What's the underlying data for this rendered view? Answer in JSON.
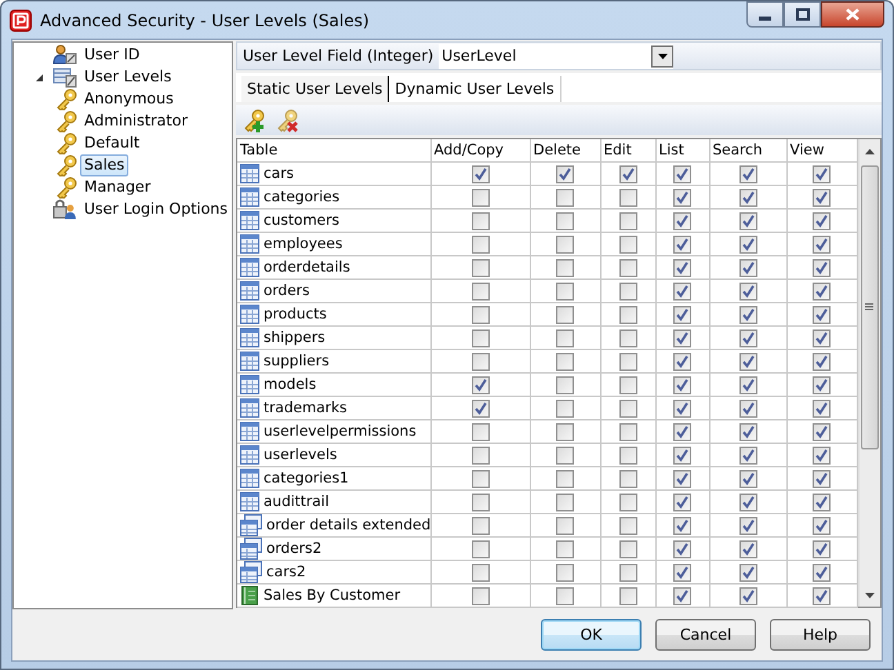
{
  "window": {
    "title": "Advanced Security - User Levels (Sales)"
  },
  "tree": [
    {
      "label": "User ID",
      "kind": "user-id",
      "selected": false
    },
    {
      "label": "User Levels",
      "kind": "user-levels",
      "selected": false,
      "expanded": true,
      "children": [
        {
          "label": "Anonymous",
          "kind": "key",
          "selected": false
        },
        {
          "label": "Administrator",
          "kind": "key",
          "selected": false
        },
        {
          "label": "Default",
          "kind": "key",
          "selected": false
        },
        {
          "label": "Sales",
          "kind": "key",
          "selected": true
        },
        {
          "label": "Manager",
          "kind": "key",
          "selected": false
        }
      ]
    },
    {
      "label": "User Login Options",
      "kind": "login",
      "selected": false
    }
  ],
  "field": {
    "label": "User Level Field (Integer)",
    "value": "UserLevel"
  },
  "tabs": [
    {
      "label": "Static User Levels",
      "selected": true
    },
    {
      "label": "Dynamic User Levels",
      "selected": false
    }
  ],
  "table": {
    "columns": [
      "Table",
      "Add/Copy",
      "Delete",
      "Edit",
      "List",
      "Search",
      "View"
    ],
    "rows": [
      {
        "name": "cars",
        "kind": "table",
        "checks": [
          true,
          true,
          true,
          true,
          true,
          true
        ]
      },
      {
        "name": "categories",
        "kind": "table",
        "checks": [
          false,
          false,
          false,
          true,
          true,
          true
        ]
      },
      {
        "name": "customers",
        "kind": "table",
        "checks": [
          false,
          false,
          false,
          true,
          true,
          true
        ]
      },
      {
        "name": "employees",
        "kind": "table",
        "checks": [
          false,
          false,
          false,
          true,
          true,
          true
        ]
      },
      {
        "name": "orderdetails",
        "kind": "table",
        "checks": [
          false,
          false,
          false,
          true,
          true,
          true
        ]
      },
      {
        "name": "orders",
        "kind": "table",
        "checks": [
          false,
          false,
          false,
          true,
          true,
          true
        ]
      },
      {
        "name": "products",
        "kind": "table",
        "checks": [
          false,
          false,
          false,
          true,
          true,
          true
        ]
      },
      {
        "name": "shippers",
        "kind": "table",
        "checks": [
          false,
          false,
          false,
          true,
          true,
          true
        ]
      },
      {
        "name": "suppliers",
        "kind": "table",
        "checks": [
          false,
          false,
          false,
          true,
          true,
          true
        ]
      },
      {
        "name": "models",
        "kind": "table",
        "checks": [
          true,
          false,
          false,
          true,
          true,
          true
        ]
      },
      {
        "name": "trademarks",
        "kind": "table",
        "checks": [
          true,
          false,
          false,
          true,
          true,
          true
        ]
      },
      {
        "name": "userlevelpermissions",
        "kind": "table",
        "checks": [
          false,
          false,
          false,
          true,
          true,
          true
        ]
      },
      {
        "name": "userlevels",
        "kind": "table",
        "checks": [
          false,
          false,
          false,
          true,
          true,
          true
        ]
      },
      {
        "name": "categories1",
        "kind": "table",
        "checks": [
          false,
          false,
          false,
          true,
          true,
          true
        ]
      },
      {
        "name": "audittrail",
        "kind": "table",
        "checks": [
          false,
          false,
          false,
          true,
          true,
          true
        ]
      },
      {
        "name": "order details extended",
        "kind": "view",
        "checks": [
          false,
          false,
          false,
          true,
          true,
          true
        ]
      },
      {
        "name": "orders2",
        "kind": "view",
        "checks": [
          false,
          false,
          false,
          true,
          true,
          true
        ]
      },
      {
        "name": "cars2",
        "kind": "view",
        "checks": [
          false,
          false,
          false,
          true,
          true,
          true
        ]
      },
      {
        "name": "Sales By Customer",
        "kind": "report",
        "checks": [
          false,
          false,
          false,
          true,
          true,
          true
        ]
      }
    ]
  },
  "buttons": [
    {
      "label": "OK",
      "default": true
    },
    {
      "label": "Cancel",
      "default": false
    },
    {
      "label": "Help",
      "default": false
    }
  ]
}
